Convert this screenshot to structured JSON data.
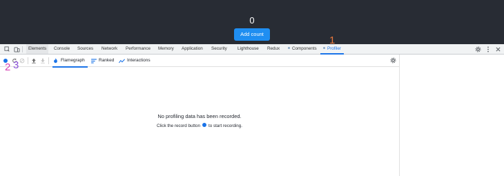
{
  "app": {
    "count": "0",
    "add_button_label": "Add count"
  },
  "devtools": {
    "tabs": [
      "Elements",
      "Console",
      "Sources",
      "Network",
      "Performance",
      "Memory",
      "Application",
      "Security",
      "Lighthouse",
      "Redux"
    ],
    "components_tab": "Components",
    "profiler_tab": "Profiler"
  },
  "profiler": {
    "tabs": [
      "Flamegraph",
      "Ranked",
      "Interactions"
    ],
    "empty_title": "No profiling data has been recorded.",
    "empty_sub_before": "Click the record button",
    "empty_sub_after": "to start recording."
  },
  "annotations": {
    "one": "1",
    "two": "2",
    "three": "3"
  },
  "colors": {
    "app_bg": "#282c34",
    "button_blue": "#1f8ef1",
    "accent_blue": "#1a73e8",
    "annotation_orange": "#e8773c",
    "annotation_pink": "#d63fb4",
    "annotation_purple": "#8a4fd8"
  },
  "icons": {
    "inspect": "inspect-element-icon",
    "device": "device-toolbar-icon",
    "settings": "gear-icon",
    "more": "more-vertical-icon",
    "close": "close-icon",
    "record": "record-icon",
    "reload": "reload-and-profile-icon",
    "clear": "clear-icon",
    "load": "load-profile-icon",
    "save": "save-profile-icon",
    "flame": "flame-icon",
    "ranked": "ranked-icon",
    "interactions": "interactions-icon"
  }
}
